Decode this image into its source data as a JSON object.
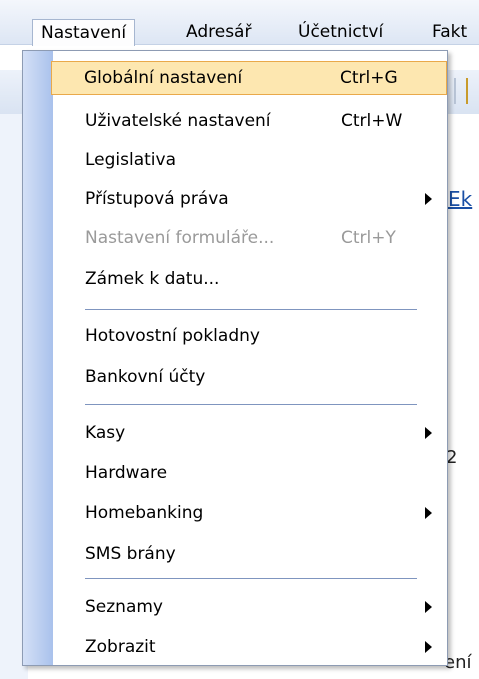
{
  "menubar": {
    "items": [
      {
        "label": "Nastavení"
      },
      {
        "label": "Adresář"
      },
      {
        "label": "Účetnictví"
      },
      {
        "label": "Fakt"
      }
    ]
  },
  "background": {
    "link_fragment": "Ek",
    "text_2": "2",
    "text_eni": "ení"
  },
  "menu": {
    "items": [
      {
        "label": "Globální nastavení",
        "shortcut": "Ctrl+G"
      },
      {
        "label": "Uživatelské nastavení",
        "shortcut": "Ctrl+W"
      },
      {
        "label": "Legislativa"
      },
      {
        "label": "Přístupová práva"
      },
      {
        "label": "Nastavení formuláře...",
        "shortcut": "Ctrl+Y"
      },
      {
        "label": "Zámek k datu..."
      },
      {
        "label": "Hotovostní pokladny"
      },
      {
        "label": "Bankovní účty"
      },
      {
        "label": "Kasy"
      },
      {
        "label": "Hardware"
      },
      {
        "label": "Homebanking"
      },
      {
        "label": "SMS brány"
      },
      {
        "label": "Seznamy"
      },
      {
        "label": "Zobrazit"
      }
    ]
  },
  "colors": {
    "highlight_bg": "#fde7b0",
    "highlight_border": "#e9a94a",
    "gutter": "#a9c1ec",
    "link": "#1a4fa5"
  }
}
